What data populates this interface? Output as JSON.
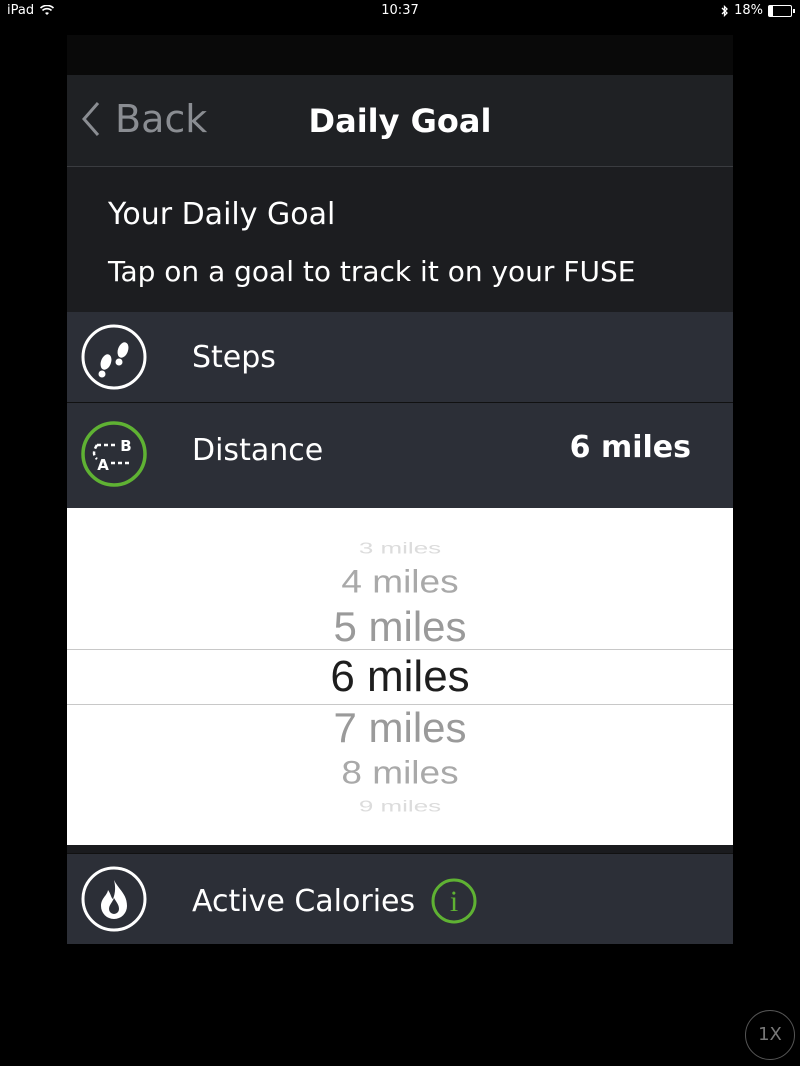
{
  "status_bar": {
    "device": "iPad",
    "time": "10:37",
    "battery": "18%",
    "battery_level": 0.18
  },
  "nav": {
    "back_label": "Back",
    "title": "Daily Goal"
  },
  "intro": {
    "heading": "Your Daily Goal",
    "subtitle": "Tap on a goal to track it on your FUSE"
  },
  "goals": {
    "steps": {
      "label": "Steps",
      "icon": "footprints-icon"
    },
    "distance": {
      "label": "Distance",
      "value": "6 miles",
      "icon": "a-to-b-route-icon"
    },
    "active_calories": {
      "label": "Active Calories",
      "icon": "flame-icon",
      "info_icon": "info-icon"
    }
  },
  "picker": {
    "options": [
      "3 miles",
      "4 miles",
      "5 miles",
      "6 miles",
      "7 miles",
      "8 miles",
      "9 miles"
    ],
    "selected": "6 miles"
  },
  "zoom_button": "1X",
  "colors": {
    "accent_green": "#5fb233",
    "row_bg": "#2c2f37",
    "nav_bg": "#1f2124"
  }
}
